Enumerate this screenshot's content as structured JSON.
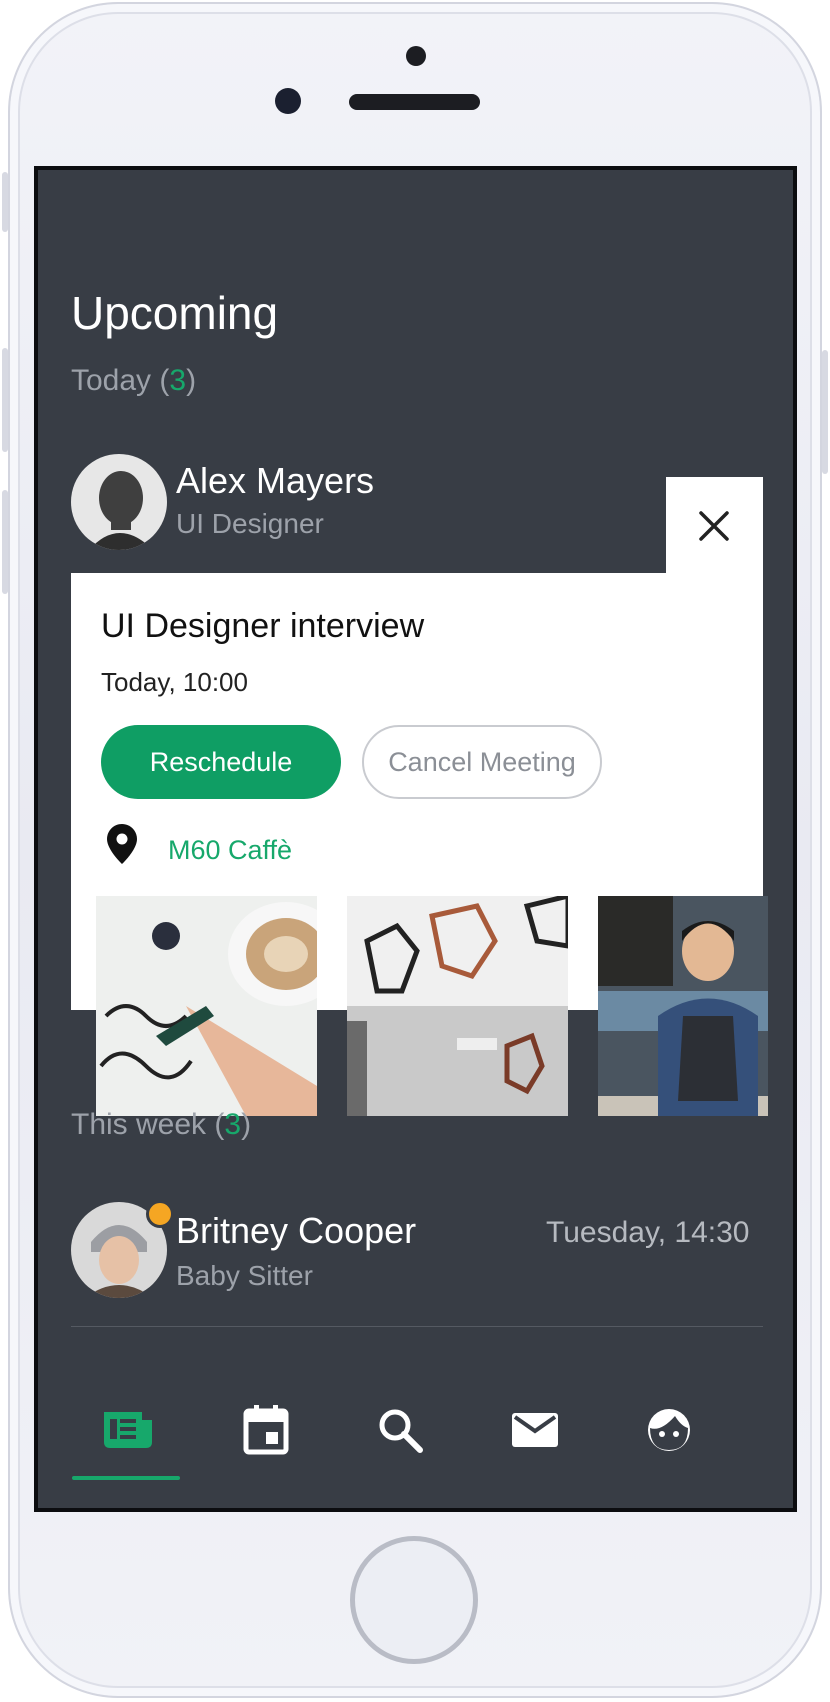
{
  "header": {
    "title": "Upcoming"
  },
  "today": {
    "label": "Today (",
    "count": "3",
    "suffix": ")"
  },
  "person_1": {
    "name": "Alex Mayers",
    "role": "UI Designer"
  },
  "meeting": {
    "title": "UI Designer interview",
    "time": "Today, 10:00",
    "primary_button": "Reschedule",
    "secondary_button": "Cancel Meeting",
    "location": "M60 Caffè",
    "photos": [
      "calligraphy-coffee-photo",
      "pendant-lamps-photo",
      "barista-photo"
    ]
  },
  "this_week": {
    "label": "This week (",
    "count": "3",
    "suffix": ")"
  },
  "person_2": {
    "name": "Britney Cooper",
    "role": "Baby Sitter",
    "time": "Tuesday, 14:30",
    "status_color": "#f5a623"
  },
  "nav": {
    "items": [
      "news-icon",
      "calendar-icon",
      "search-icon",
      "mail-icon",
      "profile-icon"
    ],
    "active_index": 0
  },
  "colors": {
    "accent": "#17a86b",
    "screen_bg": "#383d45",
    "button_green": "#0f9e64"
  }
}
